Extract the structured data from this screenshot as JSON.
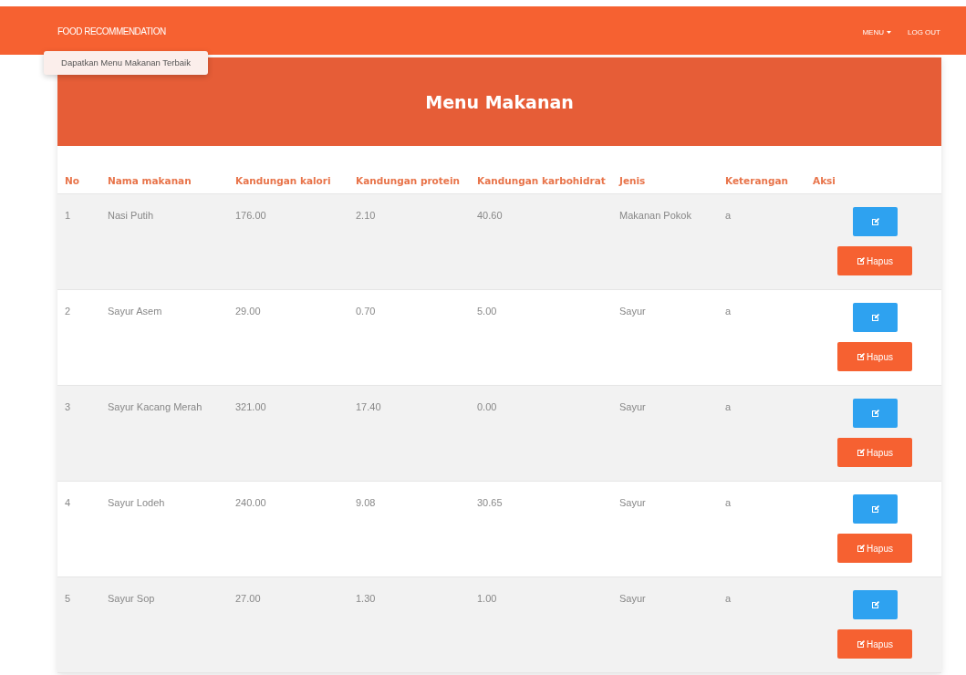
{
  "navbar": {
    "brand": "FOOD RECOMMENDATION",
    "tooltip": "Dapatkan Menu Makanan Terbaik",
    "items": [
      {
        "label": "MENU",
        "kind": "dropdown"
      },
      {
        "label": "LOG OUT",
        "kind": "link"
      }
    ]
  },
  "card": {
    "title": "Menu Makanan"
  },
  "table": {
    "columns": [
      "No",
      "Nama makanan",
      "Kandungan kalori",
      "Kandungan protein",
      "Kandungan karbohidrat",
      "Jenis",
      "Keterangan",
      "Aksi"
    ],
    "rows": [
      {
        "cells": [
          "1",
          "Nasi Putih",
          "176.00",
          "2.10",
          "40.60",
          "Makanan Pokok",
          "a"
        ],
        "delete": "Hapus"
      },
      {
        "cells": [
          "2",
          "Sayur Asem",
          "29.00",
          "0.70",
          "5.00",
          "Sayur",
          "a"
        ],
        "delete": "Hapus"
      },
      {
        "cells": [
          "3",
          "Sayur Kacang Merah",
          "321.00",
          "17.40",
          "0.00",
          "Sayur",
          "a"
        ],
        "delete": "Hapus"
      },
      {
        "cells": [
          "4",
          "Sayur Lodeh",
          "240.00",
          "9.08",
          "30.65",
          "Sayur",
          "a"
        ],
        "delete": "Hapus"
      },
      {
        "cells": [
          "5",
          "Sayur Sop",
          "27.00",
          "1.30",
          "1.00",
          "Sayur",
          "a"
        ],
        "delete": "Hapus"
      }
    ]
  }
}
